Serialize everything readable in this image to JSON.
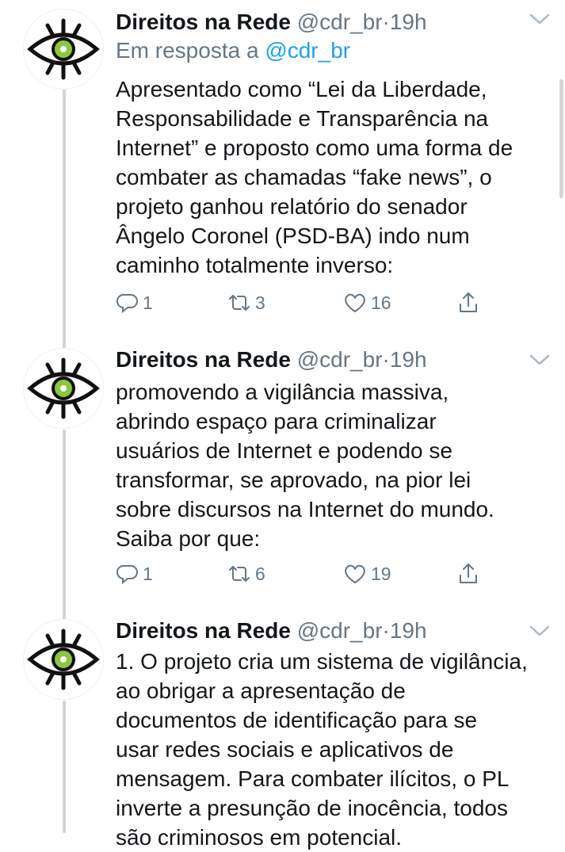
{
  "tweets": [
    {
      "name": "Direitos na Rede",
      "handle": "@cdr_br",
      "sep": "·",
      "time": "19h",
      "reply_prefix": "Em resposta a",
      "reply_to": "@cdr_br",
      "lines": [
        "Apresentado como “Lei da Liberdade,",
        "Responsabilidade e Transparência na",
        "Internet” e proposto como uma forma de",
        "combater as chamadas “fake news”, o",
        "projeto ganhou relatório do senador",
        "Ângelo Coronel (PSD-BA) indo num",
        "caminho totalmente inverso:"
      ],
      "replies": "1",
      "retweets": "3",
      "likes": "16"
    },
    {
      "name": "Direitos na Rede",
      "handle": "@cdr_br",
      "sep": "·",
      "time": "19h",
      "lines": [
        "promovendo a vigilância massiva,",
        "abrindo espaço para criminalizar",
        "usuários de Internet e podendo se",
        "transformar, se aprovado, na pior lei",
        "sobre discursos na Internet do mundo.",
        "Saiba por que:"
      ],
      "replies": "1",
      "retweets": "6",
      "likes": "19"
    },
    {
      "name": "Direitos na Rede",
      "handle": "@cdr_br",
      "sep": "·",
      "time": "19h",
      "lines": [
        "1. O projeto cria um sistema de vigilância,",
        "ao obrigar a apresentação de",
        "documentos de identificação para se",
        "usar redes sociais e aplicativos de",
        "mensagem. Para combater ilícitos, o PL",
        "inverte a presunção de inocência, todos",
        "são criminosos em potencial."
      ]
    }
  ],
  "icons": {
    "avatar": "eye-logo-icon",
    "reply": "reply-icon",
    "retweet": "retweet-icon",
    "like": "heart-icon",
    "share": "share-icon",
    "menu": "chevron-down-icon"
  },
  "colors": {
    "text": "#14171a",
    "muted": "#657786",
    "link": "#1da1f2",
    "thread_line": "#ccd6dd",
    "eye_green": "#8cc63f"
  }
}
